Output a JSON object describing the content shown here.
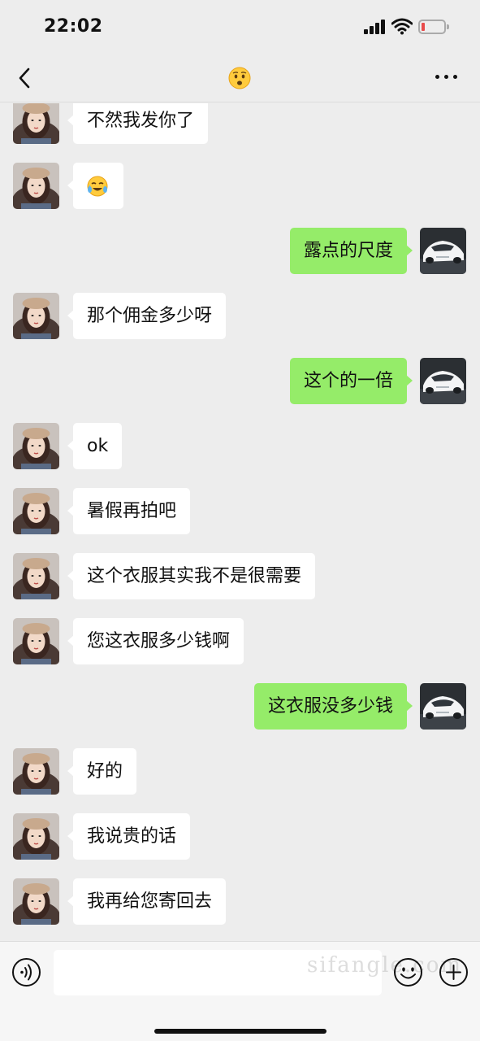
{
  "status_bar": {
    "time": "22:02"
  },
  "nav": {
    "title_emoji": "anxious-face-emoji"
  },
  "icons": {
    "back": "chevron-left-icon",
    "more": "more-dots-icon",
    "voice": "voice-icon",
    "emoji": "smiley-icon",
    "plus": "plus-icon"
  },
  "messages": [
    {
      "side": "in",
      "text": "不然我发你了"
    },
    {
      "side": "in",
      "text": "",
      "emoji": "crying-laughing-emoji"
    },
    {
      "side": "out",
      "text": "露点的尺度"
    },
    {
      "side": "in",
      "text": "那个佣金多少呀"
    },
    {
      "side": "out",
      "text": "这个的一倍"
    },
    {
      "side": "in",
      "text": "ok"
    },
    {
      "side": "in",
      "text": "暑假再拍吧"
    },
    {
      "side": "in",
      "text": "这个衣服其实我不是很需要"
    },
    {
      "side": "in",
      "text": "您这衣服多少钱啊"
    },
    {
      "side": "out",
      "text": "这衣服没多少钱"
    },
    {
      "side": "in",
      "text": "好的"
    },
    {
      "side": "in",
      "text": "我说贵的话"
    },
    {
      "side": "in",
      "text": "我再给您寄回去"
    }
  ],
  "input": {
    "value": "",
    "placeholder": ""
  },
  "watermark": "sifangle.com",
  "colors": {
    "background": "#ededed",
    "incoming_bubble": "#ffffff",
    "outgoing_bubble": "#95ec69",
    "battery_low": "#e84b4b"
  }
}
